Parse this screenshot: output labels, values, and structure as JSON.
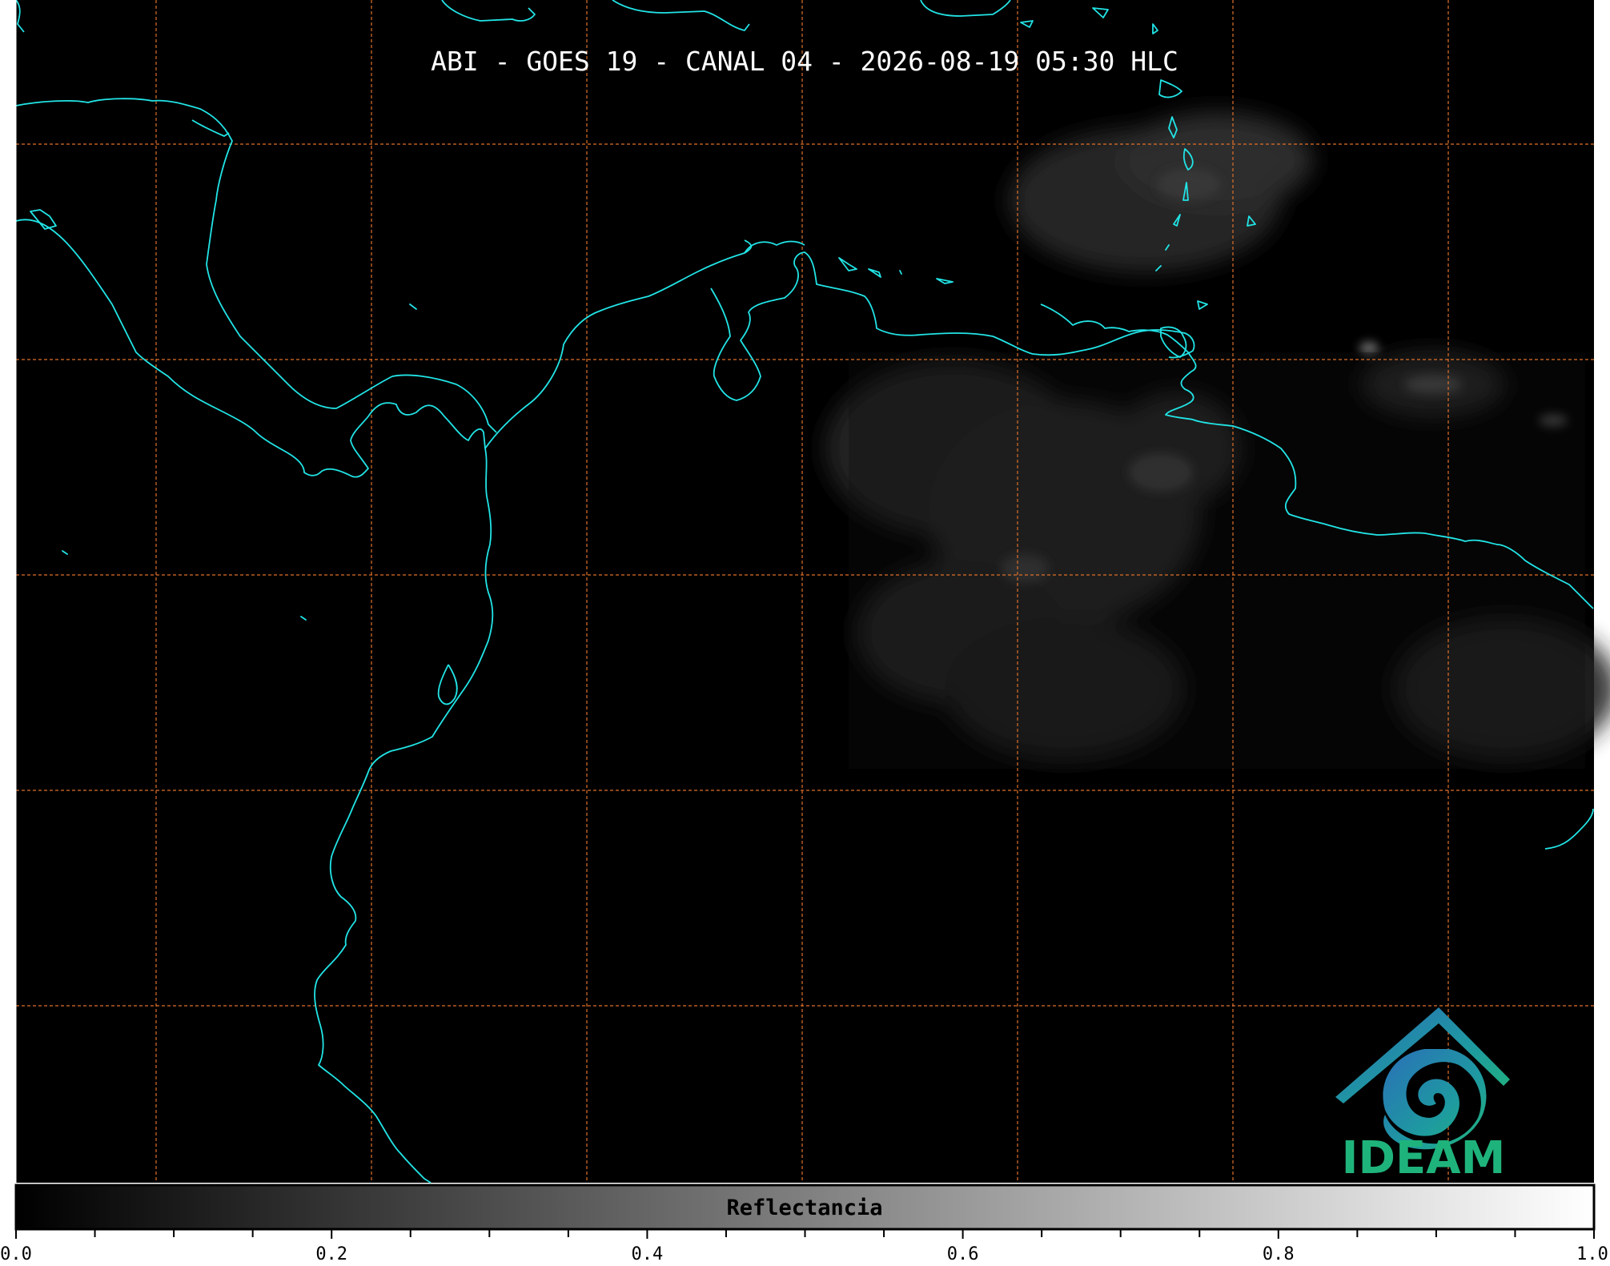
{
  "title": "ABI - GOES 19 - CANAL 04 - 2026-08-19 05:30 HLC",
  "colorbar": {
    "label": "Reflectancia",
    "ticks": [
      "0.0",
      "0.2",
      "0.4",
      "0.6",
      "0.8",
      "1.0"
    ]
  },
  "logo": {
    "text": "IDEAM"
  },
  "colors": {
    "background": "#000000",
    "coastline": "#22e4e6",
    "gridlines": "#e0702a",
    "title": "#ffffff",
    "logo_text": "#1fb37c"
  },
  "map": {
    "projection": "lat-lon grid",
    "gridlines": "dashed",
    "cloud_field": "low reflectance, east half"
  }
}
